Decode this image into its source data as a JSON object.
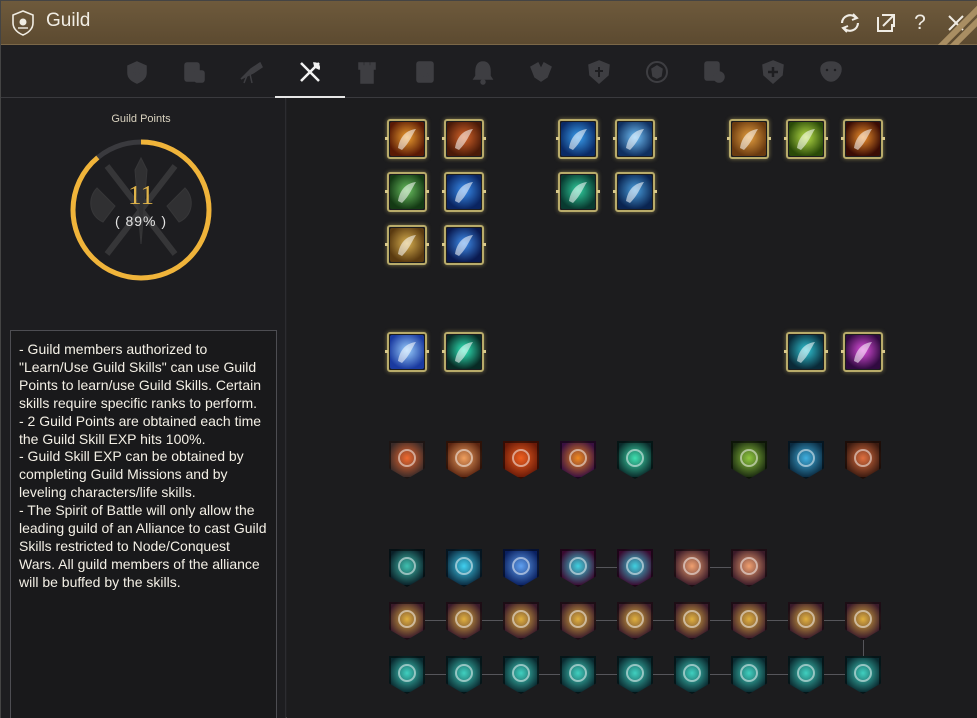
{
  "window": {
    "title": "Guild"
  },
  "titlebar_buttons": [
    {
      "name": "refresh-icon",
      "glyph": "⟳"
    },
    {
      "name": "popout-icon",
      "glyph": "⤢"
    },
    {
      "name": "help-icon",
      "glyph": "?"
    },
    {
      "name": "close-icon",
      "glyph": "✕"
    }
  ],
  "tabs": [
    {
      "name": "tab-guild-info-icon",
      "active": false
    },
    {
      "name": "tab-members-icon",
      "active": false
    },
    {
      "name": "tab-telescope-icon",
      "active": false
    },
    {
      "name": "tab-guild-skills-icon",
      "active": true
    },
    {
      "name": "tab-castle-icon",
      "active": false
    },
    {
      "name": "tab-scroll-icon",
      "active": false
    },
    {
      "name": "tab-bell-icon",
      "active": false
    },
    {
      "name": "tab-war-icon",
      "active": false
    },
    {
      "name": "tab-shield-icon",
      "active": false
    },
    {
      "name": "tab-emblem-icon",
      "active": false
    },
    {
      "name": "tab-contract-icon",
      "active": false
    },
    {
      "name": "tab-alliance-icon",
      "active": false
    },
    {
      "name": "tab-mask-icon",
      "active": false
    }
  ],
  "guild_points": {
    "label": "Guild Points",
    "value": "11",
    "percent_text": "( 89% )",
    "progress_fraction": 0.89,
    "accent_color": "#f0b43a"
  },
  "description": {
    "text": "- Guild members authorized to \"Learn/Use Guild Skills\" can use Guild Points to learn/use Guild Skills. Certain skills require specific ranks to perform.\n- 2 Guild Points are obtained each time the Guild Skill EXP hits 100%.\n- Guild Skill EXP can be obtained by completing Guild Missions and by leveling characters/life skills.\n- The Spirit of Battle will only allow the leading guild of an Alliance to cast Guild Skills restricted to Node/Conquest Wars. All guild members of the alliance will be buffed by the skills."
  },
  "skills": {
    "learned": [
      {
        "name": "fire-fist-skill-icon",
        "c1": "#f0a030",
        "c2": "#5a1a05"
      },
      {
        "name": "flame-burst-skill-icon",
        "c1": "#d8652a",
        "c2": "#4a1a08"
      },
      {
        "name": "sea-wave-skill-icon",
        "c1": "#3aa0f0",
        "c2": "#0a2a66"
      },
      {
        "name": "ship-skill-icon",
        "c1": "#70c0f8",
        "c2": "#103060"
      },
      {
        "name": "gold-hand-skill-icon",
        "c1": "#e6a040",
        "c2": "#6a3a10"
      },
      {
        "name": "green-aura-skill-icon",
        "c1": "#b8e048",
        "c2": "#2a4a08"
      },
      {
        "name": "fire-ring-skill-icon",
        "c1": "#f0902a",
        "c2": "#3a0c04"
      },
      {
        "name": "green-warrior-skill-icon",
        "c1": "#6ac060",
        "c2": "#143a14"
      },
      {
        "name": "blue-warrior-skill-icon",
        "c1": "#3a8ff0",
        "c2": "#0a2460"
      },
      {
        "name": "target-skill-icon",
        "c1": "#30d0a0",
        "c2": "#083a30"
      },
      {
        "name": "galleon-skill-icon",
        "c1": "#4aa0e0",
        "c2": "#0a2450"
      },
      {
        "name": "leaf-skill-icon",
        "c1": "#d8b050",
        "c2": "#5a3a10"
      },
      {
        "name": "blue-claw-skill-icon",
        "c1": "#4090f0",
        "c2": "#0a1a50"
      },
      {
        "name": "wing-shield-skill-icon",
        "c1": "#9ad0ff",
        "c2": "#1a3aa0"
      },
      {
        "name": "spirit-body-skill-icon",
        "c1": "#30f0c0",
        "c2": "#082a24"
      },
      {
        "name": "teal-helm-skill-icon",
        "c1": "#30c8d8",
        "c2": "#0a2a38"
      },
      {
        "name": "purple-crystal-skill-icon",
        "c1": "#e050e0",
        "c2": "#300a40"
      }
    ],
    "shields": [
      {
        "name": "dark-fortress-shield-icon",
        "c1": "#f06a30",
        "c2": "#3a2a28"
      },
      {
        "name": "sword-shield-icon",
        "c1": "#f0a060",
        "c2": "#5a2410"
      },
      {
        "name": "fire-shield-icon",
        "c1": "#f06020",
        "c2": "#6a1a08"
      },
      {
        "name": "vortex-shield-icon",
        "c1": "#f08a20",
        "c2": "#3a1040"
      },
      {
        "name": "teal-arrow-shield-icon",
        "c1": "#40e0b0",
        "c2": "#0a2a2a"
      },
      {
        "name": "green-leaf-shield-icon",
        "c1": "#90c840",
        "c2": "#1a2a10"
      },
      {
        "name": "blue-orb-shield-icon",
        "c1": "#40b0e0",
        "c2": "#0a2a40"
      },
      {
        "name": "wheel-shield-icon",
        "c1": "#e07040",
        "c2": "#3a1a10"
      },
      {
        "name": "anchor-shield-icon",
        "c1": "#40c0b0",
        "c2": "#0a2028"
      },
      {
        "name": "diamond-shield-icon",
        "c1": "#40d0f0",
        "c2": "#0a2a40"
      },
      {
        "name": "tools-shield-icon",
        "c1": "#60a0f0",
        "c2": "#0a2060"
      },
      {
        "name": "spiral-shield-1-icon",
        "c1": "#40d0e0",
        "c2": "#3a0a30"
      },
      {
        "name": "spiral-shield-2-icon",
        "c1": "#40d0e0",
        "c2": "#3a0a30"
      },
      {
        "name": "forge-shield-1-icon",
        "c1": "#f0a070",
        "c2": "#3a1a28"
      },
      {
        "name": "forge-shield-2-icon",
        "c1": "#f0a070",
        "c2": "#3a1a28"
      }
    ],
    "chest_rows": [
      {
        "name": "gold-chest-shield-icon",
        "c1": "#e0b040",
        "c2": "#3a1a2a",
        "count": 9
      },
      {
        "name": "teal-chest-shield-icon",
        "c1": "#40d0c0",
        "c2": "#0a2a30",
        "count": 9
      }
    ]
  }
}
